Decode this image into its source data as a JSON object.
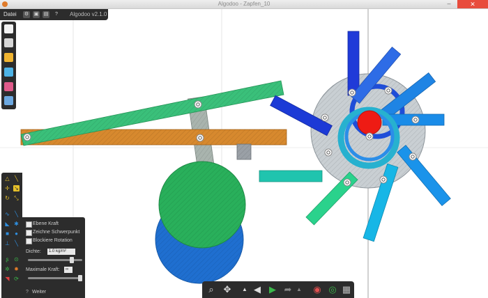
{
  "window": {
    "title": "Algodoo - Zapfen_10",
    "minimize_label": "–",
    "close_label": "✕"
  },
  "menu": {
    "file_label": "Datei",
    "help_label": "?",
    "version": "Algodoo v2.1.0"
  },
  "file_toolbar": {
    "icons": [
      "new-scene-icon",
      "save-scene-icon",
      "open-folder-icon",
      "browse-scenes-icon",
      "screenshot-icon",
      "recent-scene-icon"
    ]
  },
  "properties_panel": {
    "options": [
      {
        "label": "Ebene Kraft",
        "checked": false
      },
      {
        "label": "Zeichne Schwerpunkt",
        "checked": false
      },
      {
        "label": "Blockiere Rotation",
        "checked": false
      }
    ],
    "slider1_label": "Dichte:",
    "slider1_value": "1.0 kg/m²",
    "slider1_level": 0.84,
    "slider2_label": "Maximale Kraft:",
    "slider2_value": "∞",
    "slider2_level": 1.0,
    "more_label": "Weiter",
    "help_label": "?"
  },
  "colors": {
    "panel_bg": "#2c2c2c",
    "accent_orange": "#e07b2a"
  }
}
